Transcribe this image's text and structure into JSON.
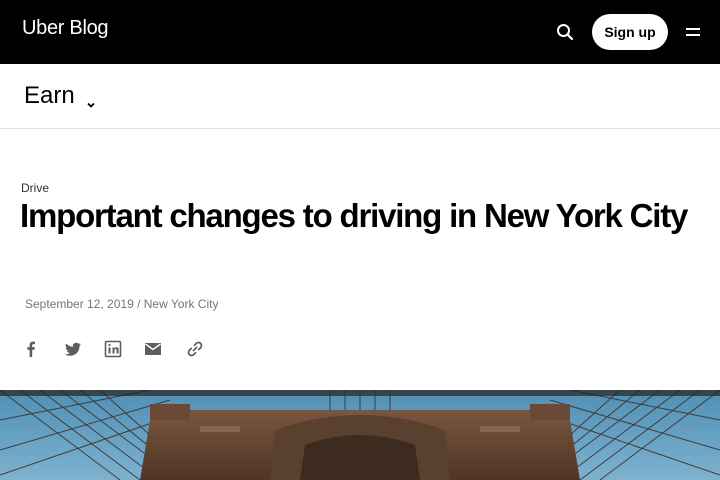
{
  "header": {
    "logo": "Uber Blog",
    "signup_label": "Sign up",
    "icons": [
      "search-icon",
      "menu-icon"
    ]
  },
  "subnav": {
    "section": "Earn",
    "icon": "chevron-down-icon"
  },
  "article": {
    "category": "Drive",
    "title": "Important changes to driving in New York City",
    "date": "September 12, 2019",
    "separator": " / ",
    "location": "New York City"
  },
  "share": {
    "icons": [
      "facebook-icon",
      "twitter-icon",
      "linkedin-icon",
      "email-icon",
      "link-icon"
    ]
  },
  "hero": {
    "subject": "Brooklyn Bridge cables photo",
    "colors": {
      "sky": "#4f8fb5",
      "stone": "#6b4a35",
      "cable": "#3a2a22"
    }
  },
  "colors": {
    "header_bg": "#000000",
    "text": "#000000",
    "muted": "#757575",
    "border": "#e2e2e2"
  }
}
